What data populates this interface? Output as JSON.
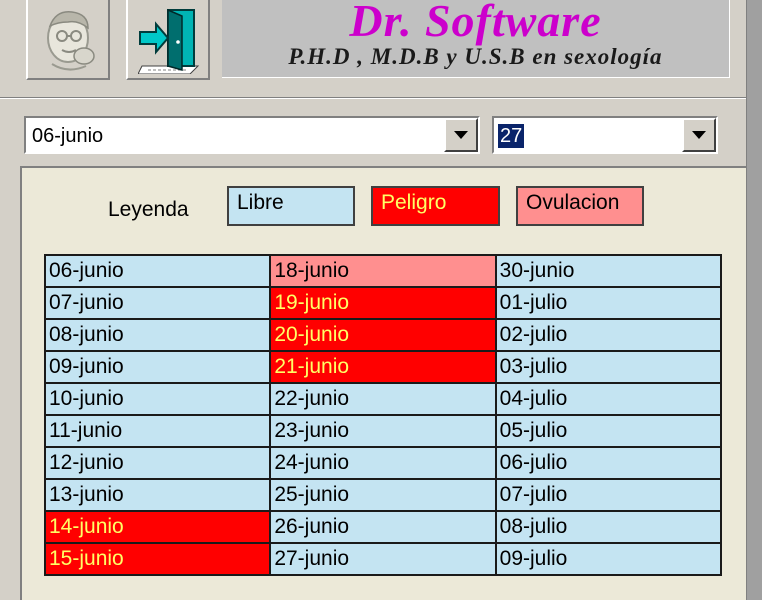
{
  "header": {
    "title": "Dr. Software",
    "subtitle": "P.H.D , M.D.B y  U.S.B en sexología",
    "doctor_button_icon": "doctor-face-icon",
    "exit_button_icon": "exit-door-icon"
  },
  "selectors": {
    "date_value": "06-junio",
    "cycle_value": "27"
  },
  "legend": {
    "label": "Leyenda",
    "items": [
      {
        "label": "Libre",
        "color": "#c4e4f2",
        "text_color": "#000000"
      },
      {
        "label": "Peligro",
        "color": "#ff0000",
        "text_color": "#ffff66"
      },
      {
        "label": "Ovulacion",
        "color": "#ff8f8f",
        "text_color": "#000000"
      }
    ]
  },
  "calendar": {
    "columns": [
      [
        {
          "date": "06-junio",
          "status": "libre"
        },
        {
          "date": "07-junio",
          "status": "libre"
        },
        {
          "date": "08-junio",
          "status": "libre"
        },
        {
          "date": "09-junio",
          "status": "libre"
        },
        {
          "date": "10-junio",
          "status": "libre"
        },
        {
          "date": "11-junio",
          "status": "libre"
        },
        {
          "date": "12-junio",
          "status": "libre"
        },
        {
          "date": "13-junio",
          "status": "libre"
        },
        {
          "date": "14-junio",
          "status": "peligro"
        },
        {
          "date": "15-junio",
          "status": "peligro"
        }
      ],
      [
        {
          "date": "18-junio",
          "status": "ovulacion"
        },
        {
          "date": "19-junio",
          "status": "peligro"
        },
        {
          "date": "20-junio",
          "status": "peligro"
        },
        {
          "date": "21-junio",
          "status": "peligro"
        },
        {
          "date": "22-junio",
          "status": "libre"
        },
        {
          "date": "23-junio",
          "status": "libre"
        },
        {
          "date": "24-junio",
          "status": "libre"
        },
        {
          "date": "25-junio",
          "status": "libre"
        },
        {
          "date": "26-junio",
          "status": "libre"
        },
        {
          "date": "27-junio",
          "status": "libre"
        }
      ],
      [
        {
          "date": "30-junio",
          "status": "libre"
        },
        {
          "date": "01-julio",
          "status": "libre"
        },
        {
          "date": "02-julio",
          "status": "libre"
        },
        {
          "date": "03-julio",
          "status": "libre"
        },
        {
          "date": "04-julio",
          "status": "libre"
        },
        {
          "date": "05-julio",
          "status": "libre"
        },
        {
          "date": "06-julio",
          "status": "libre"
        },
        {
          "date": "07-julio",
          "status": "libre"
        },
        {
          "date": "08-julio",
          "status": "libre"
        },
        {
          "date": "09-julio",
          "status": "libre"
        }
      ]
    ]
  }
}
